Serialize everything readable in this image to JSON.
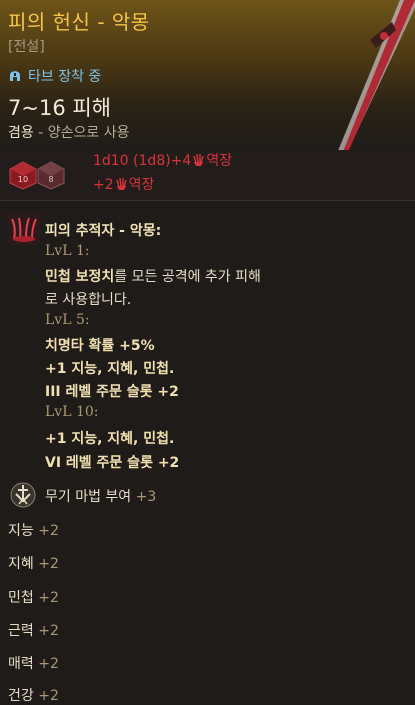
{
  "item": {
    "title": "피의 헌신 - 악몽",
    "rarity": "[전설]",
    "equipped": "타브 장착 중",
    "damage": "7~16 피해",
    "usage_a": "겸용",
    "usage_b": " - 양손으로 사용"
  },
  "damage_rows": {
    "line1_a": "1d10 (1d8)+4",
    "line1_b": "역장",
    "line2_a": "+2",
    "line2_b": "역장"
  },
  "passive": {
    "name": "피의 추적자 - 악몽:",
    "lvl1": "LvL 1:",
    "lvl1_bold": "민첩 보정치",
    "lvl1_text": "를 모든 공격에 추가 피해",
    "lvl1_text2": "로 사용합니다.",
    "lvl5": "LvL 5:",
    "lvl5_a": "치명타 확률 +5%",
    "lvl5_b": "+1 지능, 지혜, 민첩.",
    "lvl5_c": "III 레벨 주문 슬롯 +2",
    "lvl10": "LvL 10:",
    "lvl10_a": "+1 지능, 지혜, 민첩.",
    "lvl10_b": "VI 레벨 주문 슬롯 +2"
  },
  "enchant": {
    "label": "무기 마법 부여",
    "value": "+3"
  },
  "stats": [
    {
      "name": "지능",
      "value": "+2"
    },
    {
      "name": "지혜",
      "value": "+2"
    },
    {
      "name": "민첩",
      "value": "+2"
    },
    {
      "name": "근력",
      "value": "+2"
    },
    {
      "name": "매력",
      "value": "+2"
    },
    {
      "name": "건강",
      "value": "+2"
    }
  ],
  "colors": {
    "title": "#f4c545",
    "equipped": "#7fc2e6",
    "damage_red": "#d8323a",
    "level_label": "#a99873",
    "bonus": "#a99873"
  },
  "icons": [
    "helmet-icon",
    "dice-icon",
    "claw-icon",
    "blood-claw-icon",
    "enchant-icon",
    "weapon-image"
  ]
}
